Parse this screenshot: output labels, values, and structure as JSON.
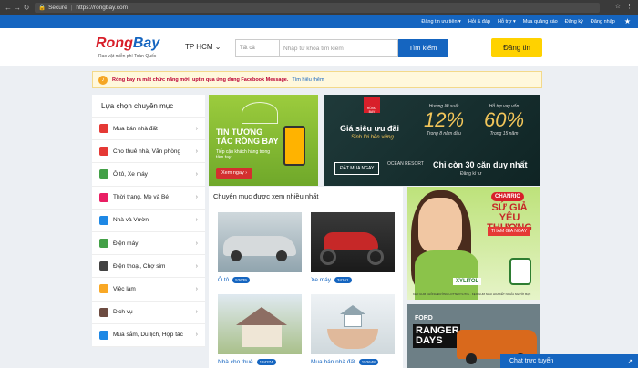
{
  "browser": {
    "secure": "Secure",
    "url": "https://rongbay.com"
  },
  "topbar": {
    "links": [
      "Đăng tin ưu tiên ▾",
      "Hỏi & đáp",
      "Hỗ trợ ▾",
      "Mua quảng cáo",
      "Đăng ký",
      "Đăng nhập"
    ]
  },
  "header": {
    "logo_a": "Rong",
    "logo_b": "Bay",
    "tagline": "Rao vặt miễn phí Toàn Quốc",
    "city": "TP HCM ⌄",
    "category_placeholder": "Tất cả",
    "search_placeholder": "Nhập từ khóa tìm kiếm",
    "search_label": "Tìm kiếm",
    "post_label": "Đăng tin"
  },
  "notice": {
    "message": "Rồng bay ra mắt chức năng mới: uptin qua ứng dụng Facebook Message.",
    "more": "Tìm hiểu thêm"
  },
  "sidebar": {
    "title": "Lựa chọn chuyên mục",
    "items": [
      {
        "label": "Mua bán nhà đất",
        "color": "#e53935"
      },
      {
        "label": "Cho thuê nhà, Văn phòng",
        "color": "#e53935"
      },
      {
        "label": "Ô tô, Xe máy",
        "color": "#43a047"
      },
      {
        "label": "Thời trang, Mẹ và Bé",
        "color": "#e91e63"
      },
      {
        "label": "Nhà và Vườn",
        "color": "#1e88e5"
      },
      {
        "label": "Điện máy",
        "color": "#43a047"
      },
      {
        "label": "Điện thoại, Chợ sim",
        "color": "#424242"
      },
      {
        "label": "Việc làm",
        "color": "#f9a825"
      },
      {
        "label": "Dịch vụ",
        "color": "#6d4c41"
      },
      {
        "label": "Mua sắm, Du lịch, Hợp tác",
        "color": "#1e88e5"
      }
    ]
  },
  "banner1": {
    "title": "TIN TƯƠNG TÁC RỒNG BAY",
    "sub": "Tiếp cận khách hàng trong tầm tay",
    "button": "Xem ngay ›"
  },
  "banner2": {
    "logo": "RỒNG BAY",
    "title": "Giá siêu ưu đãi",
    "subtitle": "Sinh lời bền vững",
    "offer1_label": "Hưởng lãi suất",
    "offer1_pct": "12%",
    "offer1_sub": "Trong 8 năm đầu",
    "offer2_label": "Hỗ trợ vay vốn",
    "offer2_pct": "60%",
    "offer2_sub": "Trong 15 năm",
    "button": "ĐẶT MUA NGAY",
    "resort": "OCEAN RESORT",
    "remaining": "Chỉ còn 30 căn duy nhất",
    "cta": "Đăng kí tư"
  },
  "popular": {
    "title": "Chuyên mục được xem nhiều nhất",
    "cards": [
      {
        "label": "Ô tô",
        "count": "52639"
      },
      {
        "label": "Xe máy",
        "count": "34161"
      },
      {
        "label": "Nhà cho thuê",
        "count": "134374"
      },
      {
        "label": "Mua bán nhà đất",
        "count": "152648"
      }
    ]
  },
  "ad1": {
    "brand": "CHANRIO",
    "slogan": "SỨ GIẢ YÊU THƯƠNG",
    "tag": "THAM GIA NGAY",
    "product": "XYLITOL",
    "foot": "KẸO GUM KHÔNG ĐƯỜNG LOTTE XYLITOL · KẸO GUM NHAI HOA KẾT NGHĨA NGƯỜI BẠN"
  },
  "ad2": {
    "brand": "FORD",
    "title": "RANGER DAYS"
  },
  "chat": {
    "label": "Chat trực tuyến"
  }
}
